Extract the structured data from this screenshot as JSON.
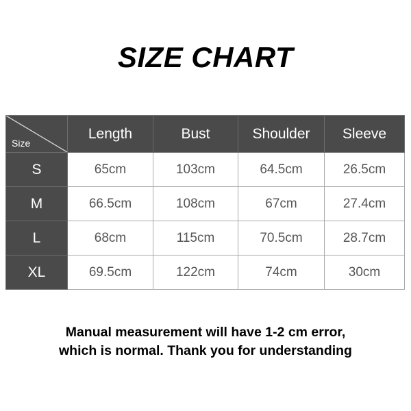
{
  "title": "SIZE CHART",
  "table": {
    "corner_label": "Size",
    "columns": [
      "Length",
      "Bust",
      "Shoulder",
      "Sleeve"
    ],
    "rows": [
      {
        "size": "S",
        "length": "65cm",
        "bust": "103cm",
        "shoulder": "64.5cm",
        "sleeve": "26.5cm"
      },
      {
        "size": "M",
        "length": "66.5cm",
        "bust": "108cm",
        "shoulder": "67cm",
        "sleeve": "27.4cm"
      },
      {
        "size": "L",
        "length": "68cm",
        "bust": "115cm",
        "shoulder": "70.5cm",
        "sleeve": "28.7cm"
      },
      {
        "size": "XL",
        "length": "69.5cm",
        "bust": "122cm",
        "shoulder": "74cm",
        "sleeve": "30cm"
      }
    ]
  },
  "footer": {
    "line1": "Manual measurement will have 1-2 cm error,",
    "line2": "which is normal. Thank you for understanding"
  },
  "colors": {
    "header_bg": "#4a4a4a",
    "header_text": "#ffffff",
    "cell_text": "#555555",
    "border": "#a8a8a8",
    "background": "#ffffff",
    "title_text": "#000000"
  }
}
